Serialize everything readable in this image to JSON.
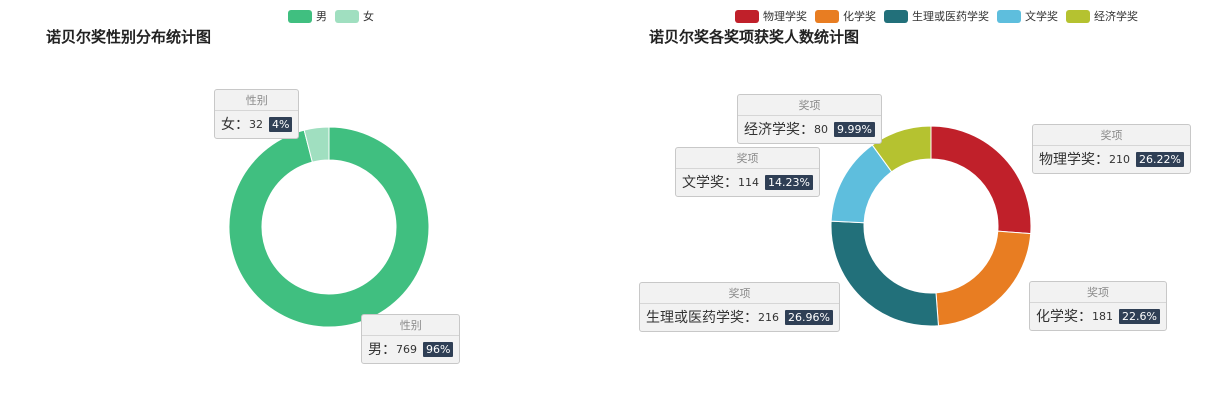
{
  "chart_data": [
    {
      "type": "pie",
      "title": "诺贝尔奖性别分布统计图",
      "legend_position": "top-center",
      "tooltip_header": "性别",
      "name_suffix": "：",
      "slices": [
        {
          "name": "男",
          "value": 769,
          "percent_label": "96%",
          "color": "#40bf80"
        },
        {
          "name": "女",
          "value": 32,
          "percent_label": "4%",
          "color": "#a0dfc0"
        }
      ]
    },
    {
      "type": "pie",
      "title": "诺贝尔奖各奖项获奖人数统计图",
      "legend_position": "top-right",
      "tooltip_header": "奖项",
      "name_suffix": "：",
      "slices": [
        {
          "name": "物理学奖",
          "value": 210,
          "percent_label": "26.22%",
          "color": "#c0202a"
        },
        {
          "name": "化学奖",
          "value": 181,
          "percent_label": "22.6%",
          "color": "#e87d22"
        },
        {
          "name": "生理或医药学奖",
          "value": 216,
          "percent_label": "26.96%",
          "color": "#22707a"
        },
        {
          "name": "文学奖",
          "value": 114,
          "percent_label": "14.23%",
          "color": "#5ebedd"
        },
        {
          "name": "经济学奖",
          "value": 80,
          "percent_label": "9.99%",
          "color": "#b5c230"
        }
      ]
    }
  ]
}
